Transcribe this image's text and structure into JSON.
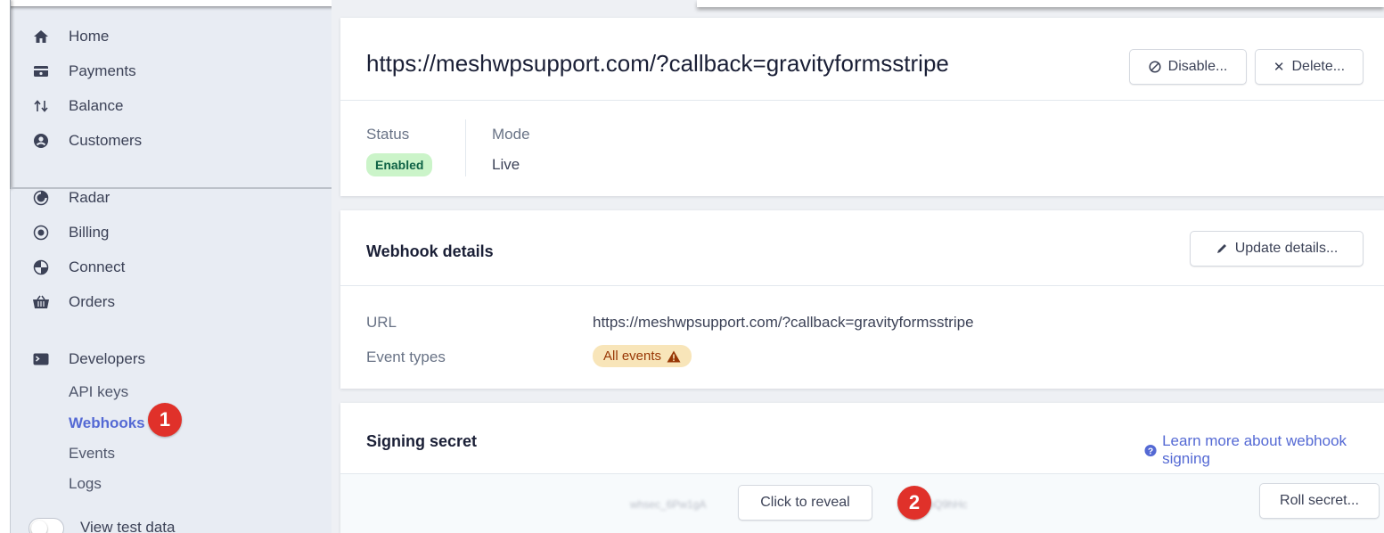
{
  "sidebar": {
    "items": [
      {
        "label": "Home",
        "icon": "home-icon"
      },
      {
        "label": "Payments",
        "icon": "payments-icon"
      },
      {
        "label": "Balance",
        "icon": "balance-icon"
      },
      {
        "label": "Customers",
        "icon": "customers-icon"
      },
      {
        "label": "Radar",
        "icon": "radar-icon"
      },
      {
        "label": "Billing",
        "icon": "billing-icon"
      },
      {
        "label": "Connect",
        "icon": "connect-icon"
      },
      {
        "label": "Orders",
        "icon": "orders-icon"
      },
      {
        "label": "Developers",
        "icon": "terminal-icon"
      }
    ],
    "developers_sub": [
      "API keys",
      "Webhooks",
      "Events",
      "Logs"
    ],
    "test_data_label": "View test data"
  },
  "callouts": {
    "one": "1",
    "two": "2"
  },
  "endpoint": {
    "title": "https://meshwpsupport.com/?callback=gravityformsstripe",
    "disable_label": "Disable...",
    "delete_label": "Delete...",
    "status_label": "Status",
    "status_value": "Enabled",
    "mode_label": "Mode",
    "mode_value": "Live"
  },
  "details": {
    "title": "Webhook details",
    "update_label": "Update details...",
    "url_label": "URL",
    "url_value": "https://meshwpsupport.com/?callback=gravityformsstripe",
    "event_types_label": "Event types",
    "event_types_value": "All events"
  },
  "signing": {
    "title": "Signing secret",
    "learn_more": "Learn more about webhook signing",
    "masked_left": "whsec_6Pw1gA",
    "masked_right": "x19bQ9hHc",
    "reveal_label": "Click to reveal",
    "roll_label": "Roll secret..."
  },
  "colors": {
    "accent": "#5469d4",
    "callout": "#e0312a",
    "status_green_bg": "#cbf4c9",
    "warning_bg": "#f8e5b9"
  }
}
